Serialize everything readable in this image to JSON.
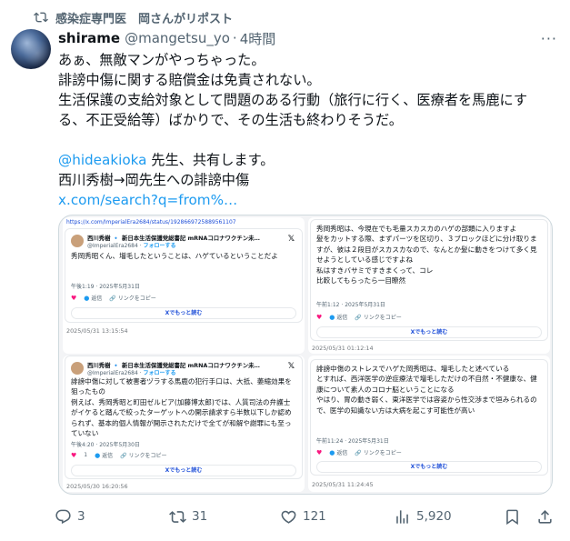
{
  "repost": {
    "text": "感染症専門医　岡さんがリポスト",
    "icon": "repost-icon"
  },
  "author": {
    "name": "shirame",
    "handle": "@mangetsu_yo",
    "separator": "·",
    "time": "4時間"
  },
  "menu": {
    "label": "···"
  },
  "tweet": {
    "line1": "あぁ、無敵マンがやっちゃった。",
    "line2": "誹謗中傷に関する賠償金は免責されない。",
    "line3": "生活保護の支給対象として問題のある行動（旅行に行く、医療者を馬鹿にする、不正受給等）ばかりで、その生活も終わりそうだ。",
    "mention": "@hideakioka",
    "line4_rest": " 先生、共有します。",
    "line5": "西川秀樹→岡先生への誹謗中傷",
    "link": "x.com/search?q=from%…"
  },
  "media": {
    "shot1": {
      "url": "https://x.com/ImperialEra2684/status/1928669725889561107",
      "account": "西川秀樹 🔹 新日本生活保護党総書記 mRNAコロナワクチン未…",
      "sub_handle": "@ImperialEra2684 · ",
      "follow": "フォローする",
      "text": "秀岡秀昭くん、増毛したということは、ハゲているということだよ",
      "meta": "午後1:19 · 2025年5月31日",
      "reply": "返信",
      "copy": "リンクをコピー",
      "readmore": "Xでもっと読む",
      "stamp": "2025/05/31 13:15:54"
    },
    "shot2": {
      "text": "秀岡秀昭は、今現在でも毛量スカスカのハゲの部類に入りますよ\n髪をカットする際、まずパーツを区切り、３ブロックほどに分け取りますが、彼は２段目がスカスカなので、なんとか髪に動きをつけて多く見せようとしている感じですよね\n私はすきバサミですきまくって、コレ\n比較してもらったら一目瞭然",
      "meta": "午前1:12 · 2025年5月31日",
      "reply": "返信",
      "copy": "リンクをコピー",
      "readmore": "Xでもっと読む",
      "stamp": "2025/05/31 01:12:14"
    },
    "shot3": {
      "account": "西川秀樹 🔹 新日本生活保護党総書記 mRNAコロナワクチン未…",
      "sub_handle": "@ImperialEra2684 · ",
      "follow": "フォローする",
      "text": "誹謗中傷に対して被害者ヅラする馬鹿の犯行手口は、大抵、萎縮効果を狙ったもの\n例えば、秀岡秀昭と町田ゼルビア(加藤博太郎)では、人質司法の弁護士がイケると踏んで絞ったターゲットへの開示請求すら半数以下しか認められず、基本的個人情報が開示されただけで全てが和解や謝罪にも至っていない",
      "meta": "午後4:20 · 2025年5月30日",
      "likes": "1",
      "reply": "返信",
      "copy": "リンクをコピー",
      "readmore": "Xでもっと読む",
      "stamp": "2025/05/30 16:20:56"
    },
    "shot4": {
      "text": "誹謗中傷のストレスでハゲた岡秀昭は、増毛したと述べている\nとすれば、西洋医学の逆症療法で増毛しただけの不自然・不健康な、健康について素人のコロナ脳ということになる\nやはり、胃の動き弱く、東洋医学では容姿から性交渉まで垣みられるので、医学の知識ない方は大病を起こす可能性が高い",
      "meta": "午前11:24 · 2025年5月31日",
      "reply": "返信",
      "copy": "リンクをコピー",
      "readmore": "Xでもっと読む",
      "stamp": "2025/05/31 11:24:45"
    }
  },
  "stats": {
    "replies": "3",
    "reposts": "31",
    "likes": "121",
    "views": "5,920"
  },
  "colors": {
    "accent": "#1d9bf0",
    "muted": "#536471",
    "text": "#0f1419",
    "like": "#f91880"
  }
}
